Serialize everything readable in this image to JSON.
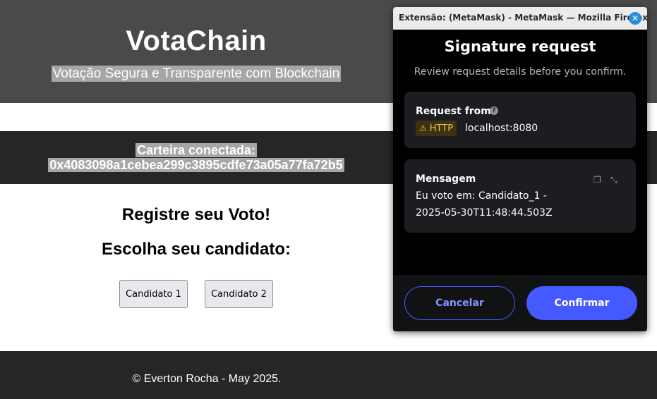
{
  "site": {
    "title": "VotaChain",
    "subtitle": "Votação Segura e Transparente com Blockchain",
    "wallet_label": "Carteira conectada:",
    "wallet_address": "0x4083098a1cebea299c3895cdfe73a05a77fa72b5",
    "vote_title": "Registre seu Voto!",
    "vote_subtitle": "Escolha seu candidato:",
    "candidates": [
      "Candidato 1",
      "Candidato 2"
    ],
    "footer": "© Everton Rocha - May 2025."
  },
  "metamask": {
    "window_title": "Extensão: (MetaMask) - MetaMask — Mozilla Firefox",
    "close_glyph": "✕",
    "heading": "Signature request",
    "subheading": "Review request details before you confirm.",
    "request_from_label": "Request from",
    "help_glyph": "?",
    "protocol_badge": "HTTP",
    "warning_glyph": "⚠",
    "host": "localhost:8080",
    "message_label": "Mensagem",
    "message_line1": "Eu voto em: Candidato_1 -",
    "message_line2": "2025-05-30T11:48:44.503Z",
    "copy_glyph": "❐",
    "collapse_glyph": "⤡",
    "cancel_label": "Cancelar",
    "confirm_label": "Confirmar"
  },
  "colors": {
    "header_bg": "#4a4a4a",
    "bar_bg": "#262626",
    "highlight": "#a6a6a6",
    "mm_accent": "#4459ff",
    "mm_warning": "#f5c542"
  }
}
